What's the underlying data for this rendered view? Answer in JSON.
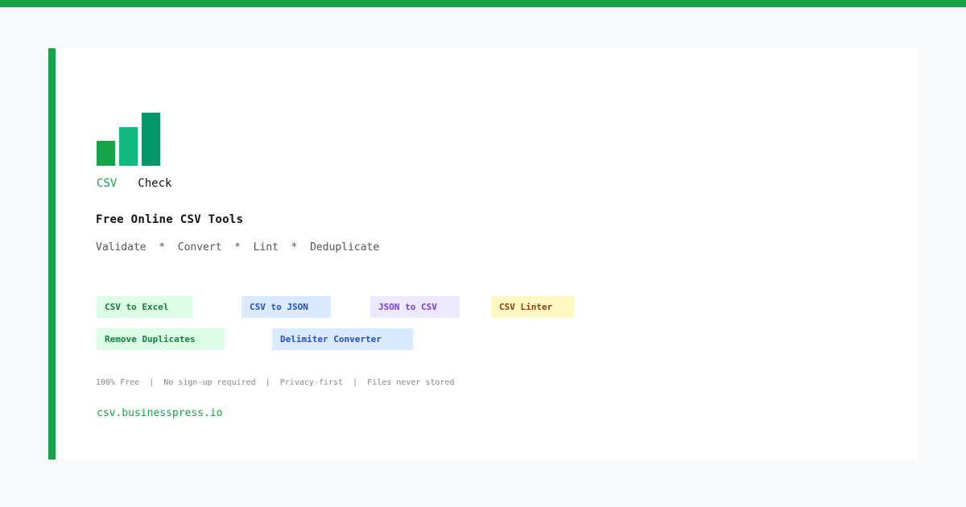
{
  "brand": {
    "part1": "CSV",
    "part2": "Check"
  },
  "headline": "Free Online CSV Tools",
  "features": "Validate  *  Convert  *  Lint  *  Deduplicate",
  "tags": [
    {
      "label": "CSV to Excel"
    },
    {
      "label": "CSV to JSON"
    },
    {
      "label": "JSON to CSV"
    },
    {
      "label": "CSV Linter"
    },
    {
      "label": "Remove Duplicates"
    },
    {
      "label": "Delimiter Converter"
    }
  ],
  "footnote": "100% Free  |  No sign-up required  |  Privacy-first  |  Files never stored",
  "url": "csv.businesspress.io",
  "colors": {
    "accent": "#16a34a",
    "bar2": "#10b981",
    "bar3": "#059669"
  }
}
